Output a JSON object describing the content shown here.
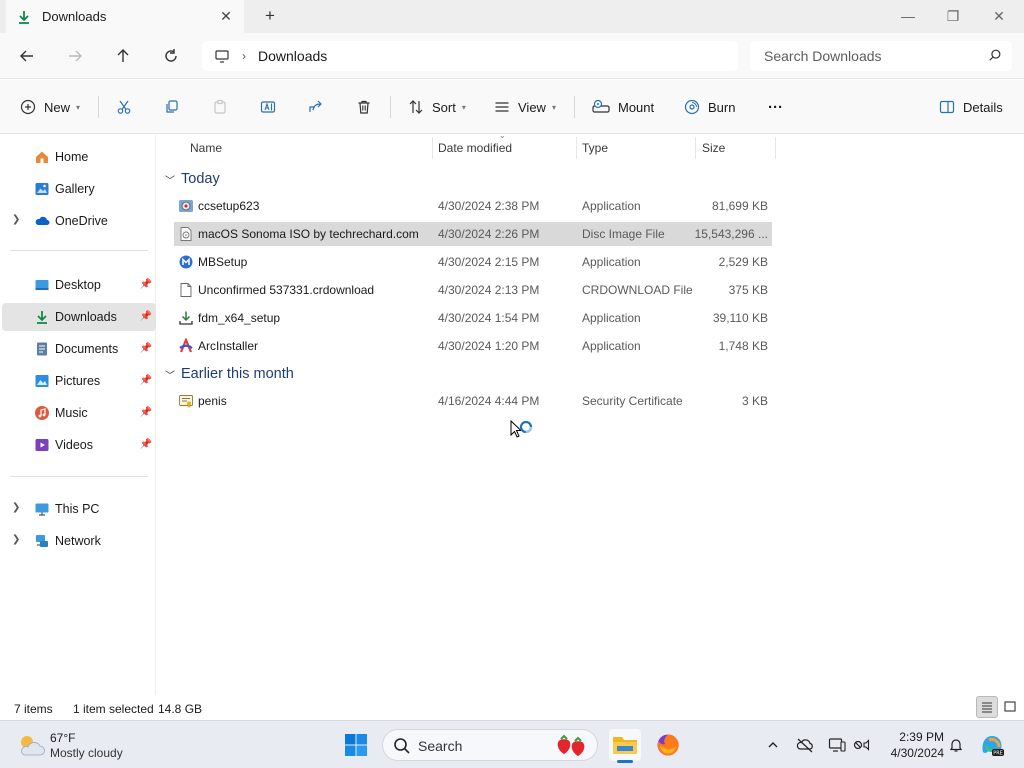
{
  "window": {
    "tab_title": "Downloads",
    "tab_close": "✕",
    "new_tab": "+",
    "minimize": "—",
    "restore": "❐",
    "close": "✕"
  },
  "address_bar": {
    "breadcrumb_separator": "›",
    "current_folder": "Downloads",
    "search_placeholder": "Search Downloads"
  },
  "commands": {
    "new": "New",
    "sort": "Sort",
    "view": "View",
    "mount": "Mount",
    "burn": "Burn",
    "more": "···",
    "details": "Details"
  },
  "nav": {
    "home": "Home",
    "gallery": "Gallery",
    "onedrive": "OneDrive",
    "desktop": "Desktop",
    "downloads": "Downloads",
    "documents": "Documents",
    "pictures": "Pictures",
    "music": "Music",
    "videos": "Videos",
    "this_pc": "This PC",
    "network": "Network",
    "selected": "Downloads"
  },
  "columns": {
    "name": "Name",
    "date": "Date modified",
    "type": "Type",
    "size": "Size"
  },
  "groups": {
    "today": "Today",
    "earlier": "Earlier this month"
  },
  "files": [
    {
      "name": "ccsetup623",
      "date": "4/30/2024 2:38 PM",
      "type": "Application",
      "size": "81,699 KB",
      "icon": "setup-app-icon"
    },
    {
      "name": "macOS Sonoma ISO by techrechard.com",
      "date": "4/30/2024 2:26 PM",
      "type": "Disc Image File",
      "size": "15,543,296 ...",
      "icon": "disc-image-icon",
      "selected": true
    },
    {
      "name": "MBSetup",
      "date": "4/30/2024 2:15 PM",
      "type": "Application",
      "size": "2,529 KB",
      "icon": "malwarebytes-icon"
    },
    {
      "name": "Unconfirmed 537331.crdownload",
      "date": "4/30/2024 2:13 PM",
      "type": "CRDOWNLOAD File",
      "size": "375 KB",
      "icon": "blank-file-icon"
    },
    {
      "name": "fdm_x64_setup",
      "date": "4/30/2024 1:54 PM",
      "type": "Application",
      "size": "39,110 KB",
      "icon": "download-manager-icon"
    },
    {
      "name": "ArcInstaller",
      "date": "4/30/2024 1:20 PM",
      "type": "Application",
      "size": "1,748 KB",
      "icon": "arc-browser-icon"
    },
    {
      "name": "penis",
      "date": "4/16/2024 4:44 PM",
      "type": "Security Certificate",
      "size": "3 KB",
      "icon": "certificate-icon"
    }
  ],
  "status": {
    "item_count": "7 items",
    "selection": "1 item selected",
    "selection_size": "14.8 GB"
  },
  "taskbar": {
    "temperature": "67°F",
    "weather": "Mostly cloudy",
    "search_label": "Search",
    "time": "2:39 PM",
    "date": "4/30/2024"
  },
  "colors": {
    "accent": "#1a73c9",
    "group_header": "#1f3d70",
    "selection": "#d9d9d9",
    "downloads_green": "#0f8a4a"
  }
}
